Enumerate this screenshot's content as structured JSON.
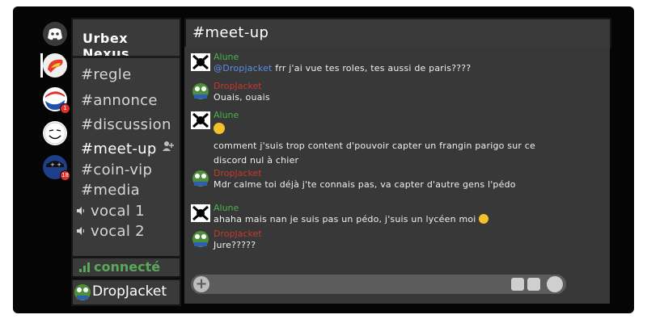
{
  "server": {
    "name": "Urbex Nexus"
  },
  "servers": [
    {
      "icon": "discord-logo-icon",
      "badge": ""
    },
    {
      "icon": "server-avatar-red-yellow-icon",
      "badge": ""
    },
    {
      "icon": "server-avatar-pepsi-icon",
      "badge": "1"
    },
    {
      "icon": "server-avatar-troll-face-icon",
      "badge": ""
    },
    {
      "icon": "server-avatar-blue-character-icon",
      "badge": "18"
    }
  ],
  "channels": [
    {
      "label": "#regle"
    },
    {
      "label": "#annonce"
    },
    {
      "label": "#discussion"
    },
    {
      "label": "#meet-up",
      "active": true
    },
    {
      "label": "#coin-vip"
    },
    {
      "label": "#media"
    },
    {
      "label": "vocal 1",
      "icon": "speaker-icon"
    },
    {
      "label": "vocal 2",
      "icon": "speaker-icon"
    }
  ],
  "status": {
    "label": "connecté"
  },
  "user": {
    "name": "DropJacket"
  },
  "chat": {
    "title": "#meet-up",
    "messages": [
      {
        "author": "Alune",
        "author_color": "#47b547",
        "lines": [
          "@Dropjacket",
          "frr  j'ai vue tes roles, tes aussi de paris????"
        ]
      },
      {
        "author": "DropJacket",
        "author_color": "#c5392f",
        "lines": [
          "Ouais, ouais"
        ]
      },
      {
        "author": "Alune",
        "author_color": "#47b547",
        "lines": [
          "comment j'suis trop content d'pouvoir capter un frangin parigo sur ce",
          "discord nul à chier"
        ]
      },
      {
        "author": "DropJacket",
        "author_color": "#c5392f",
        "lines": [
          "Mdr calme toi déjà j'te connais pas, va capter d'autre gens l'pédo"
        ]
      },
      {
        "author": "Alune",
        "author_color": "#47b547",
        "lines": [
          "ahaha mais nan je suis pas un pédo, j'suis un lycéen moi"
        ]
      },
      {
        "author": "DropJacket",
        "author_color": "#c5392f",
        "lines": [
          "Jure?????"
        ]
      }
    ]
  },
  "input": {
    "value": ""
  },
  "colors": {
    "background": "#050505",
    "panel": "#3a3a3a",
    "chat": "#383838",
    "mention": "#5b8fe0"
  }
}
